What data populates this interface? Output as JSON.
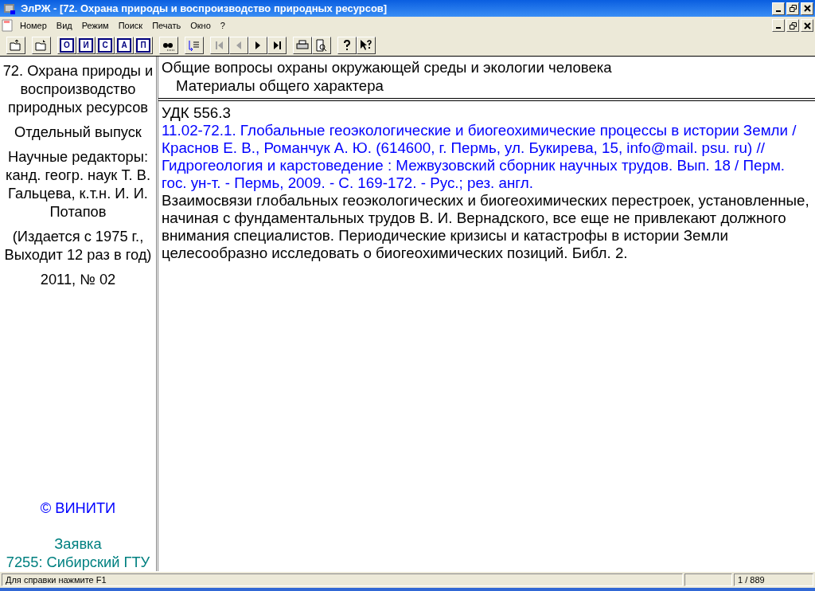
{
  "window": {
    "title": "ЭлРЖ - [72. Охрана природы и воспроизводство природных ресурсов]"
  },
  "menu": [
    "Номер",
    "Вид",
    "Режим",
    "Поиск",
    "Печать",
    "Окно",
    "?"
  ],
  "toolbar": {
    "letters": [
      "О",
      "И",
      "С",
      "А",
      "П"
    ],
    "nav": [
      {
        "kind": "first",
        "disabled": true
      },
      {
        "kind": "prev",
        "disabled": true
      },
      {
        "kind": "next",
        "disabled": false
      },
      {
        "kind": "last",
        "disabled": false
      }
    ]
  },
  "sidebar": {
    "title": "72. Охрана природы и воспроизводство природных ресурсов",
    "issue_type": "Отдельный выпуск",
    "editors": "Научные редакторы: канд. геогр. наук Т. В. Гальцева, к.т.н. И. И. Потапов",
    "frequency": "(Издается с 1975 г., Выходит 12 раз в год)",
    "issue": "2011, № 02",
    "copyright": "© ВИНИТИ",
    "request_label": "Заявка",
    "request": "7255: Сибирский ГТУ"
  },
  "header": {
    "section": "Общие вопросы охраны окружающей среды и экологии человека",
    "subsection": "Материалы общего характера"
  },
  "article": {
    "udc": "УДК 556.3",
    "citation": "11.02-72.1. Глобальные геоэкологические и биогеохимические процессы в истории Земли / Краснов Е. В., Романчук А. Ю. (614600, г. Пермь, ул. Букирева, 15, info@mail. psu. ru) // Гидрогеология и карстоведение : Межвузовский сборник научных трудов. Вып. 18 / Перм. гос. ун-т. - Пермь, 2009. - С. 169-172. - Рус.; рез. англ.",
    "abstract": "Взаимосвязи глобальных геоэкологических и биогеохимических перестроек, установленные, начиная с фундаментальных трудов В. И. Вернадского, все еще не привлекают должного внимания специалистов. Периодические кризисы и катастрофы в истории Земли целесообразно исследовать о биогеохимических позиций. Библ. 2."
  },
  "status_bar": {
    "hint": "Для справки нажмите F1",
    "position": "1 / 889"
  }
}
